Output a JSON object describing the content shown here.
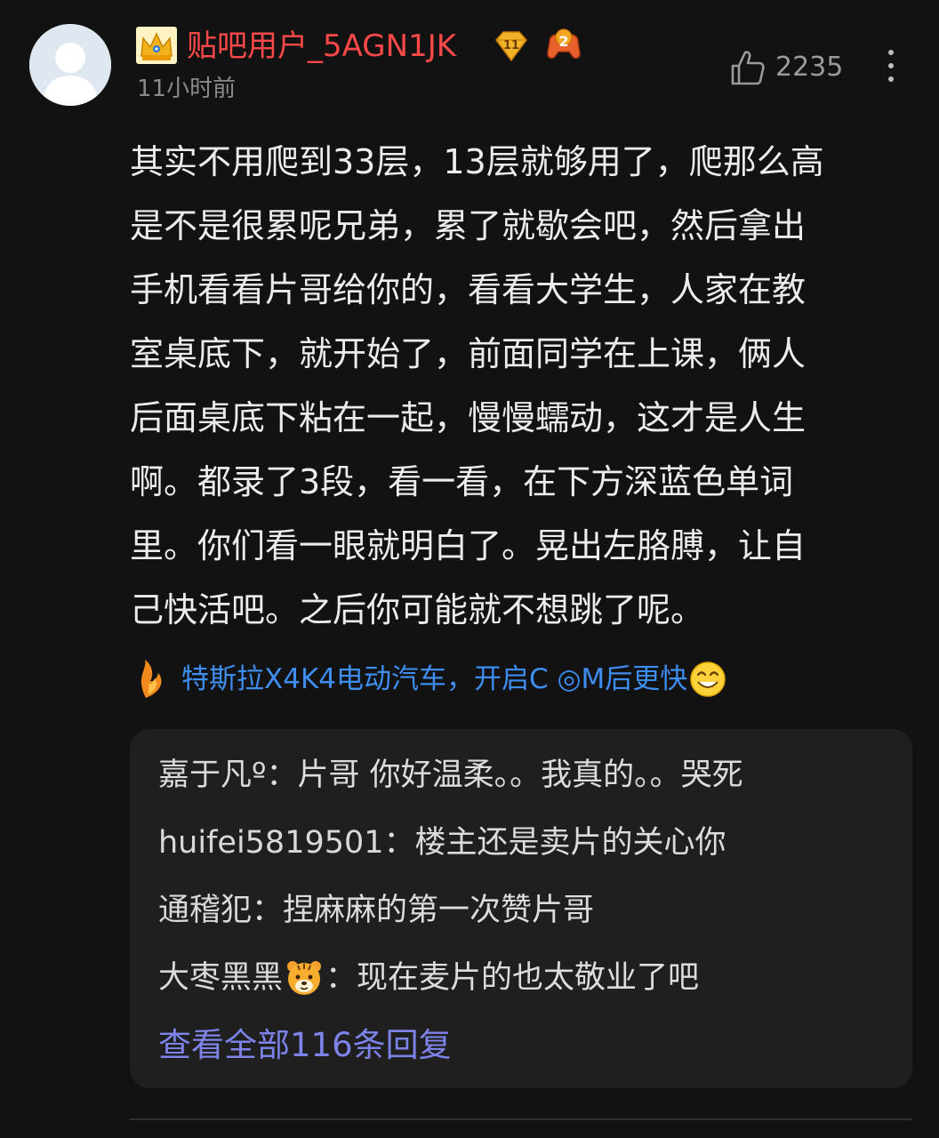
{
  "post": {
    "username": "贴吧用户_5AGN1JK",
    "level": "11",
    "game_badge_number": "2",
    "time": "11小时前",
    "like_count": "2235",
    "content_lines": [
      "其实不用爬到33层，13层就够用了，爬那么高",
      "是不是很累呢兄弟，累了就歇会吧，然后拿出",
      "手机看看片哥给你的，看看大学生，人家在教",
      "室桌底下，就开始了，前面同学在上课，俩人",
      "后面桌底下粘在一起，慢慢蠕动，这才是人生",
      "啊。都录了3段，看一看，在下方深蓝色单词",
      "里。你们看一眼就明白了。晃出左胳膊，让自",
      "己快活吧。之后你可能就不想跳了呢。"
    ],
    "tail_text": "特斯拉X4K4电动汽车，开启C ◎M后更快"
  },
  "replies": {
    "items": [
      {
        "user": "嘉于凡º",
        "text": "：片哥 你好温柔。。我真的。。哭死"
      },
      {
        "user": "huifei5819501",
        "text": "：楼主还是卖片的关心你"
      },
      {
        "user": "通稽犯",
        "text": "：捏麻麻的第一次赞片哥"
      },
      {
        "user": "大枣黑黑",
        "text": "：现在麦片的也太敬业了吧"
      }
    ],
    "view_all": "查看全部116条回复"
  },
  "colors": {
    "background": "#121212",
    "username": "#ff4949",
    "link_blue": "#3d8ef0",
    "view_all": "#7d83e8",
    "reply_box": "#1f1f1f"
  },
  "icons": {
    "avatar": "default-avatar-icon",
    "crown": "crown-badge-icon",
    "level": "level-gem-icon",
    "game": "game-controller-badge-icon",
    "like": "thumbs-up-icon",
    "more": "more-vertical-icon",
    "tail": "tail-flame-icon",
    "smiley": "smiley-icon",
    "tiger": "tiger-emoji-icon"
  }
}
